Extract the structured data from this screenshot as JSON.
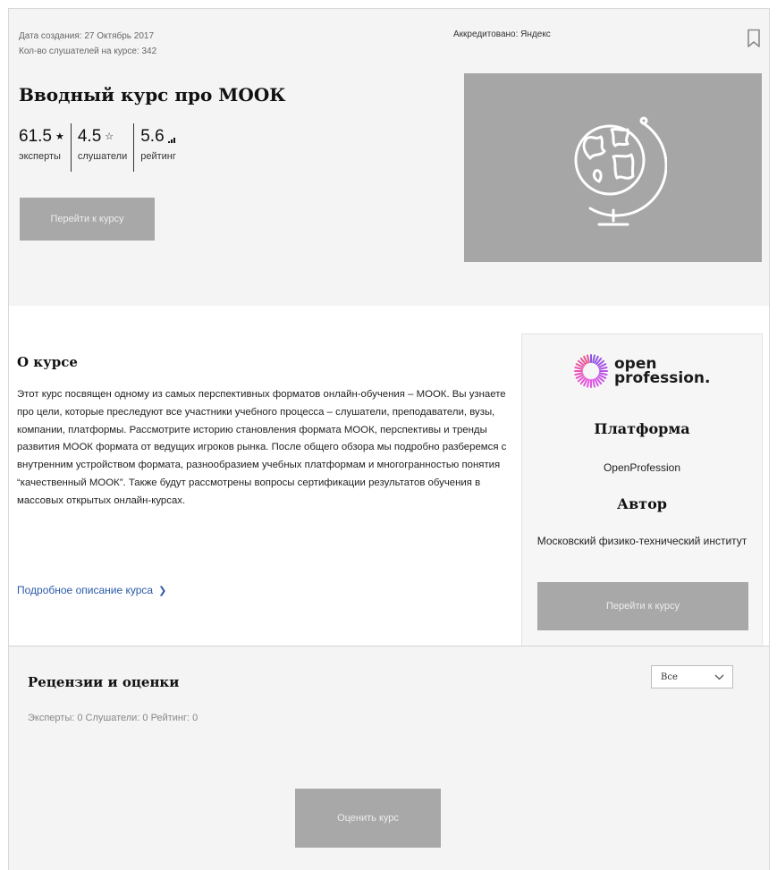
{
  "header": {
    "created_label": "Дата создания: 27 Октябрь 2017",
    "listeners_label": "Кол-во слушателей на курсе: 342",
    "accredited": "Аккредитовано: Яндекс",
    "title": "Вводный курс про МООК",
    "stats": [
      {
        "value": "61.5",
        "icon": "★",
        "icon_name": "star-filled-icon",
        "label": "эксперты"
      },
      {
        "value": "4.5",
        "icon": "☆",
        "icon_name": "star-outline-icon",
        "label": "слушатели"
      },
      {
        "value": "5.6",
        "icon": "▂▄",
        "icon_name": "rating-bars-icon",
        "label": "рейтинг"
      }
    ],
    "go_button": "Перейти к курсу"
  },
  "about": {
    "title": "О курсе",
    "text": "Этот курс посвящен одному из самых перспективных форматов онлайн-обучения – МООК. Вы узнаете про цели, которые преследуют все участники учебного процесса – слушатели, преподаватели, вузы, компании, платформы. Рассмотрите историю становления формата МООК, перспективы и тренды развития МООК формата от ведущих игроков рынка. После общего обзора мы подробно разберемся с внутренним устройством формата, разнообразием учебных платформам и многогранностью понятия “качественный МООК”. Также будут рассмотрены вопросы сертификации результатов обучения в массовых открытых онлайн-курсах.",
    "link": "Подробное описание курса"
  },
  "card": {
    "logo_line1": "open",
    "logo_line2": "profession.",
    "platform_heading": "Платформа",
    "platform": "OpenProfession",
    "author_heading": "Автор",
    "author": "Московский физико-технический институт",
    "go_button": "Перейти к курсу"
  },
  "reviews": {
    "title": "Рецензии и оценки",
    "summary": "Эксперты: 0 Слушатели: 0 Рейтинг: 0",
    "filter_value": "Все",
    "rate_button": "Оценить курс"
  },
  "colors": {
    "header_bg": "#f4f4f4",
    "button_bg": "#a8a8a8",
    "link": "#2b5aa8",
    "hero_bg": "#a6a6a6"
  }
}
